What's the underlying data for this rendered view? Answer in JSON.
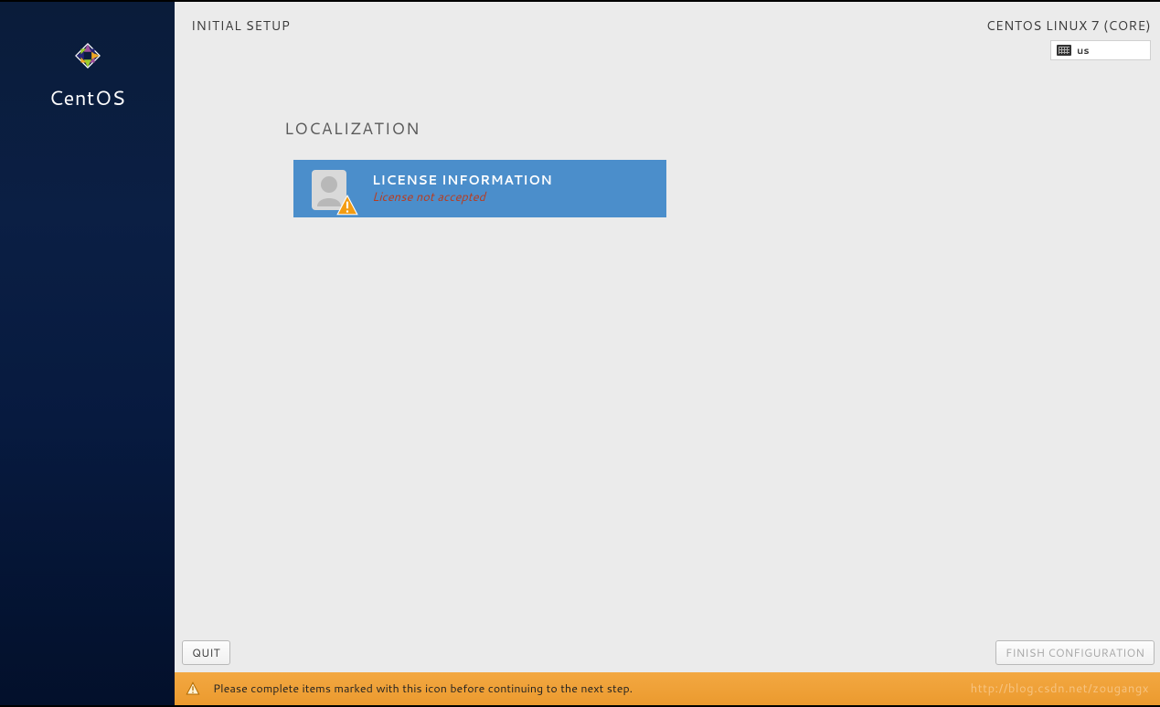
{
  "sidebar": {
    "wordmark": "CentOS"
  },
  "header": {
    "title": "INITIAL SETUP",
    "distro": "CENTOS LINUX 7 (CORE)",
    "keyboard_layout": "us"
  },
  "content": {
    "section_title": "LOCALIZATION",
    "license_spoke": {
      "title": "LICENSE INFORMATION",
      "status": "License not accepted"
    }
  },
  "footer": {
    "quit_label": "QUIT",
    "finish_label": "FINISH CONFIGURATION"
  },
  "warning_bar": {
    "message": "Please complete items marked with this icon before continuing to the next step.",
    "watermark": "http://blog.csdn.net/zougangx"
  },
  "colors": {
    "accent": "#4b8ecb",
    "sidebar_bg": "#0b1f44",
    "warning_bg": "#f0a13a",
    "status_error": "#b93c1f"
  }
}
